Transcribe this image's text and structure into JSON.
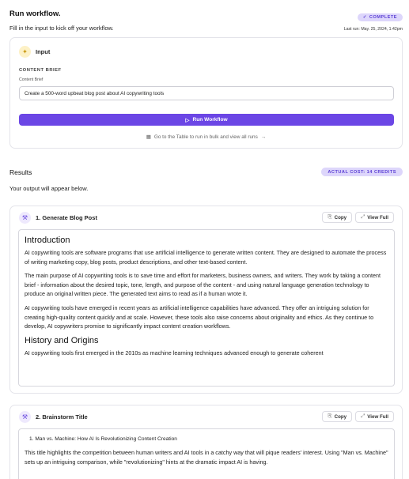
{
  "header": {
    "title": "Run workflow.",
    "subtitle": "Fill in the input to kick off your workflow.",
    "status_badge": "COMPLETE",
    "last_run": "Last run: May. 25, 2024, 1:42pm"
  },
  "input_card": {
    "heading": "Input",
    "section_label": "CONTENT BRIEF",
    "field_label": "Content Brief",
    "field_value": "Create a 500-word upbeat blog post about AI copywriting tools",
    "run_button": "Run Workflow",
    "table_link": "Go to the Table to run in bulk and view all runs"
  },
  "results": {
    "title": "Results",
    "credits_badge": "ACTUAL COST: 14 CREDITS",
    "subtitle": "Your output will appear below."
  },
  "outputs": [
    {
      "title": "1. Generate Blog Post",
      "copy_label": "Copy",
      "view_label": "View Full",
      "heading1": "Introduction",
      "paragraphs": [
        "AI copywriting tools are software programs that use artificial intelligence to generate written content. They are designed to automate the process of writing marketing copy, blog posts, product descriptions, and other text-based content.",
        "The main purpose of AI copywriting tools is to save time and effort for marketers, business owners, and writers. They work by taking a content brief - information about the desired topic, tone, length, and purpose of the content - and using natural language generation technology to produce an original written piece. The generated text aims to read as if a human wrote it.",
        "AI copywriting tools have emerged in recent years as artificial intelligence capabilities have advanced. They offer an intriguing solution for creating high-quality content quickly and at scale. However, these tools also raise concerns about originality and ethics. As they continue to develop, AI copywriters promise to significantly impact content creation workflows."
      ],
      "heading2": "History and Origins",
      "trailing": "AI copywriting tools first emerged in the 2010s as machine learning techniques advanced enough to generate coherent"
    },
    {
      "title": "2. Brainstorm Title",
      "copy_label": "Copy",
      "view_label": "View Full",
      "list_item": "1. Man vs. Machine: How AI Is Revolutionizing Content Creation",
      "paragraph": "This title highlights the competition between human writers and AI tools in a catchy way that will pique readers' interest. Using \"Man vs. Machine\" sets up an intriguing comparison, while \"revolutionizing\" hints at the dramatic impact AI is having."
    }
  ],
  "icons": {
    "input": "spark-icon",
    "run": "play-icon",
    "table": "table-icon",
    "arrow": "arrow-right-icon",
    "output": "magic-wand-icon",
    "copy": "clipboard-icon",
    "expand": "expand-icon",
    "check": "check-icon"
  },
  "colors": {
    "accent": "#6b46e5",
    "badge_bg": "#ddd6fb",
    "badge_text": "#5b3fd4"
  }
}
